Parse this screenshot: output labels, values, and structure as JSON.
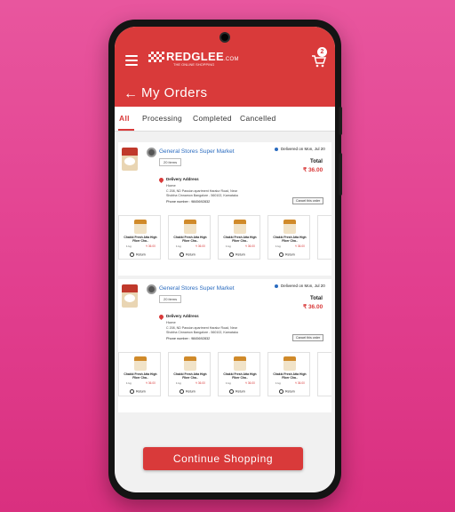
{
  "app": {
    "brand": "REDGLEE",
    "brand_suffix": ".COM",
    "tagline": "THE ONLINE SHOPPING",
    "cart_count": "2",
    "page_title": "My Orders",
    "back_symbol": "←"
  },
  "tabs": [
    {
      "label": "All",
      "active": true
    },
    {
      "label": "Processing"
    },
    {
      "label": "Completed"
    },
    {
      "label": "Cancelled"
    }
  ],
  "orders": [
    {
      "shop": "General Stores Super Market",
      "items_count": "20  items",
      "status": "Delivered on Mon, Jul 20",
      "total_label": "Total",
      "total": "₹ 36.00",
      "address_title": "Delivery Address",
      "address_type": "Home",
      "address": "C 208, ND Passion apartment Haralur Road, Near Shobha Cinnamon Bangalore - 560102, Karnataka",
      "phone": "Phone number : 9845692832",
      "cancel_label": "Cancel this order",
      "products": [
        {
          "name": "Chakki Fresh Atta High Fiber Cha..",
          "qty": "1 kg",
          "price": "₹ 36.00",
          "action": "Return"
        },
        {
          "name": "Chakki Fresh Atta High Fiber Cha..",
          "qty": "1 kg",
          "price": "₹ 36.00",
          "action": "Return"
        },
        {
          "name": "Chakki Fresh Atta High Fiber Cha..",
          "qty": "1 kg",
          "price": "₹ 36.00",
          "action": "Return"
        },
        {
          "name": "Chakki Fresh Atta High Fiber Cha..",
          "qty": "1 kg",
          "price": "₹ 36.00",
          "action": "Return"
        }
      ]
    },
    {
      "shop": "General Stores Super Market",
      "items_count": "20  items",
      "status": "Delivered on Mon, Jul 20",
      "total_label": "Total",
      "total": "₹ 36.00",
      "address_title": "Delivery Address",
      "address_type": "Home",
      "address": "C 208, ND Passion apartment Haralur Road, Near Shobha Cinnamon Bangalore - 560102, Karnataka",
      "phone": "Phone number : 9845692832",
      "cancel_label": "Cancel this order",
      "products": [
        {
          "name": "Chakki Fresh Atta High Fiber Cha..",
          "qty": "1 kg",
          "price": "₹ 36.00",
          "action": "Return"
        },
        {
          "name": "Chakki Fresh Atta High Fiber Cha..",
          "qty": "1 kg",
          "price": "₹ 36.00",
          "action": "Return"
        },
        {
          "name": "Chakki Fresh Atta High Fiber Cha..",
          "qty": "1 kg",
          "price": "₹ 36.00",
          "action": "Return"
        },
        {
          "name": "Chakki Fresh Atta High Fiber Cha..",
          "qty": "1 kg",
          "price": "₹ 36.00",
          "action": "Return"
        }
      ]
    }
  ],
  "footer": {
    "continue_label": "Continue Shopping"
  },
  "colors": {
    "accent": "#d93a3a",
    "background": "#e23f8f",
    "link": "#2a6bbf"
  }
}
